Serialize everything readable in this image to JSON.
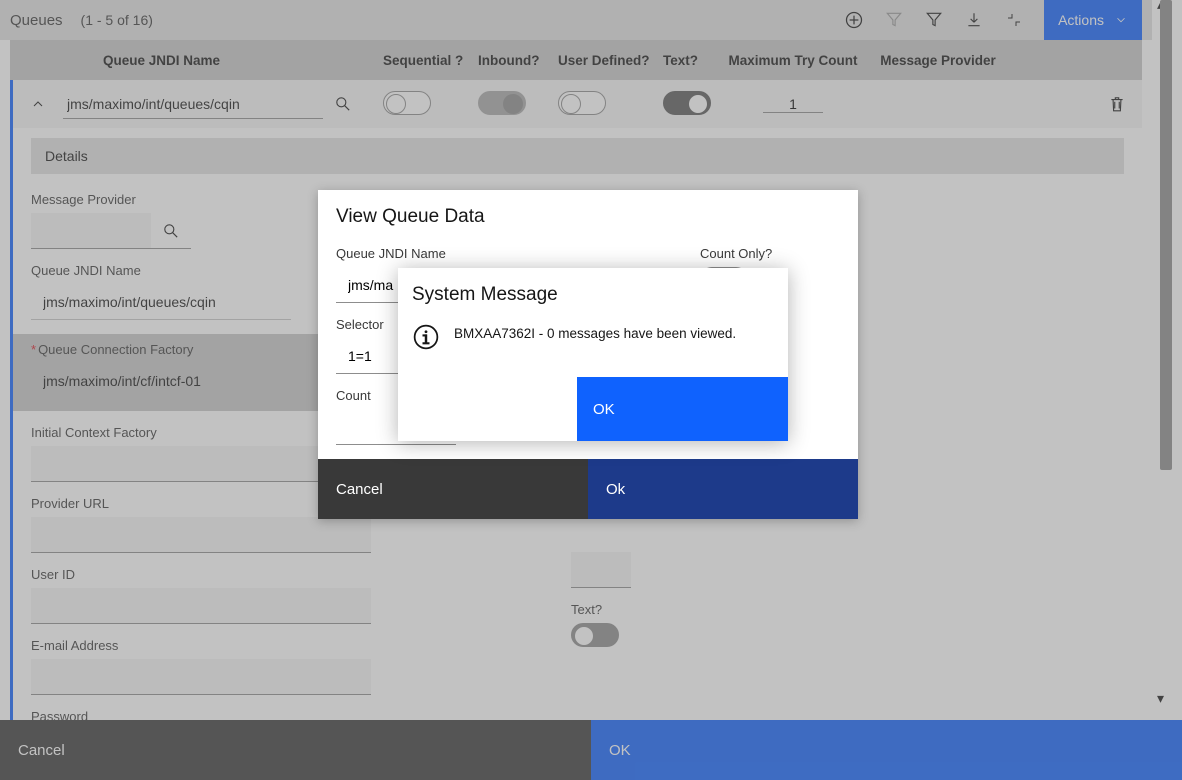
{
  "header": {
    "title": "Queues",
    "range": "(1 - 5 of 16)",
    "actions_label": "Actions"
  },
  "columns": {
    "jndi": "Queue JNDI Name",
    "seq": "Sequential ?",
    "inb": "Inbound?",
    "ud": "User Defined?",
    "txt": "Text?",
    "try": "Maximum Try Count",
    "prov": "Message Provider"
  },
  "row": {
    "jndi": "jms/maximo/int/queues/cqin",
    "sequential": false,
    "inbound": true,
    "user_defined": false,
    "text": true,
    "max_try": "1",
    "provider": ""
  },
  "details": {
    "header": "Details",
    "labels": {
      "message_provider": "Message Provider",
      "jndi": "Queue JNDI Name",
      "qcf": "Queue Connection Factory",
      "icf": "Initial Context Factory",
      "purl": "Provider URL",
      "uid": "User ID",
      "email": "E-mail Address",
      "pwd": "Password",
      "text": "Text?"
    },
    "values": {
      "message_provider": "",
      "jndi": "jms/maximo/int/queues/cqin",
      "qcf": "jms/maximo/int/cf/intcf-01",
      "icf": "",
      "purl": "",
      "uid": "",
      "email": "",
      "pwd": ""
    }
  },
  "page_footer": {
    "cancel": "Cancel",
    "ok": "OK"
  },
  "vqd": {
    "title": "View Queue Data",
    "labels": {
      "jndi": "Queue JNDI Name",
      "count_only": "Count Only?",
      "selector": "Selector",
      "count": "Count"
    },
    "values": {
      "jndi": "jms/ma",
      "selector": "1=1",
      "count": ""
    },
    "footer": {
      "cancel": "Cancel",
      "ok": "Ok"
    }
  },
  "msg": {
    "title": "System Message",
    "text": "BMXAA7362I - 0 messages have been viewed.",
    "ok": "OK"
  }
}
